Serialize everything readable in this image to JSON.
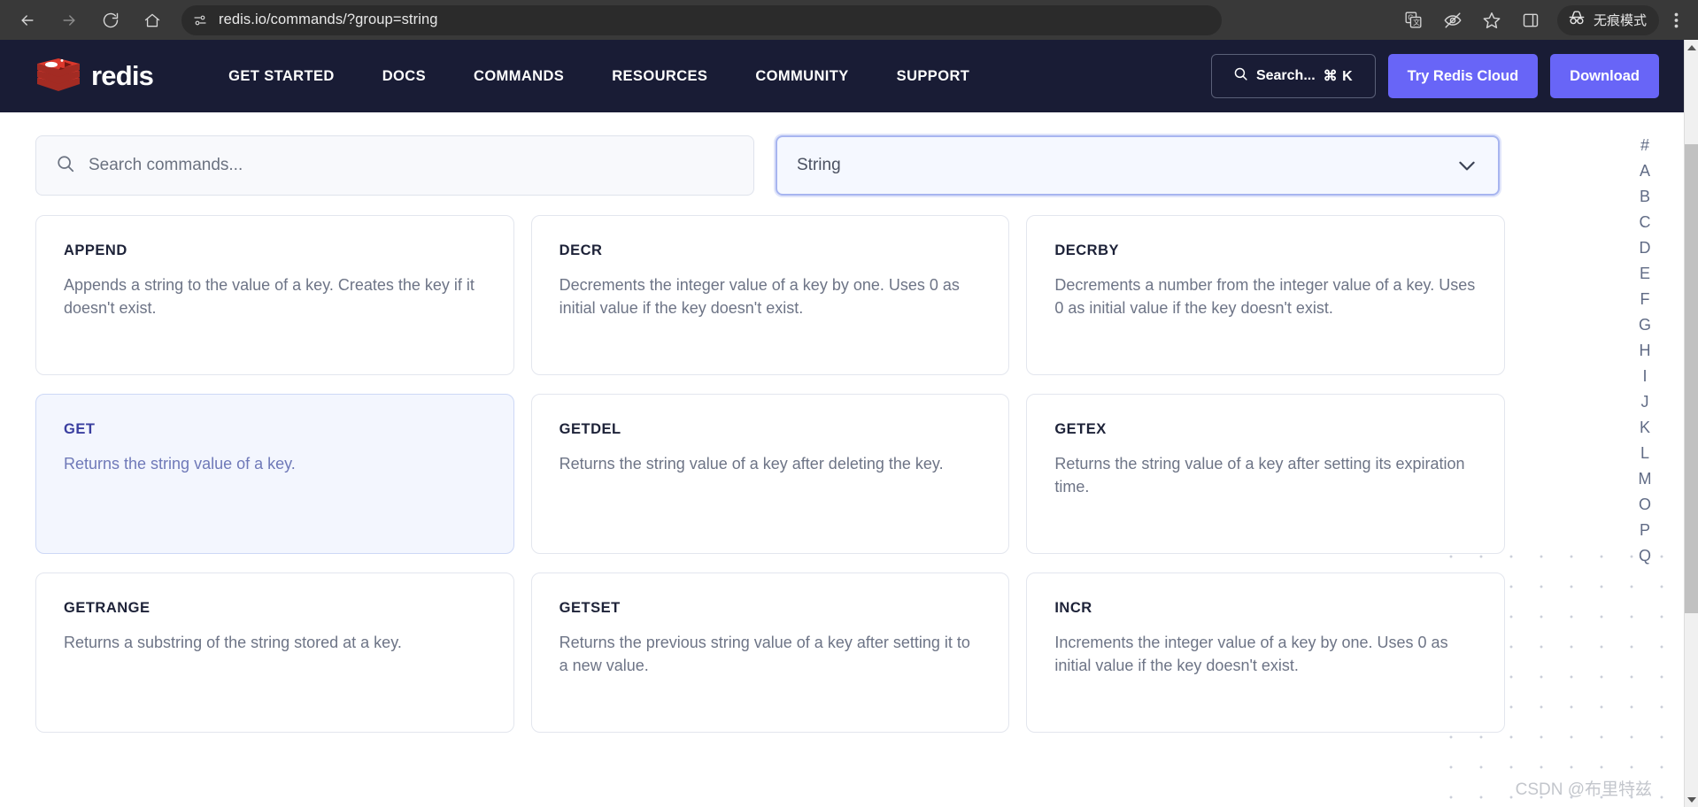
{
  "browser": {
    "url": "redis.io/commands/?group=string",
    "icons": {
      "back": "back-arrow-icon",
      "forward": "forward-arrow-icon",
      "reload": "reload-icon",
      "home": "home-icon",
      "site_info": "site-info-icon",
      "translate": "translate-icon",
      "tracking_protection": "eye-off-icon",
      "bookmark": "star-icon",
      "side_panel": "side-panel-icon",
      "incognito": "incognito-icon",
      "menu": "three-dot-menu-icon"
    },
    "incognito_label": "无痕模式"
  },
  "site_nav": {
    "brand": "redis",
    "menu": [
      "GET STARTED",
      "DOCS",
      "COMMANDS",
      "RESOURCES",
      "COMMUNITY",
      "SUPPORT"
    ],
    "search_label": "Search...",
    "search_shortcut": "⌘ K",
    "cta_primary": "Try Redis Cloud",
    "cta_secondary": "Download",
    "accent_color": "#6865f7",
    "background_color": "#191c35"
  },
  "filters": {
    "search_placeholder": "Search commands...",
    "search_value": "",
    "group_value": "String",
    "group_focused": true
  },
  "commands": [
    {
      "name": "APPEND",
      "description": "Appends a string to the value of a key. Creates the key if it doesn't exist.",
      "active": false
    },
    {
      "name": "DECR",
      "description": "Decrements the integer value of a key by one. Uses 0 as initial value if the key doesn't exist.",
      "active": false
    },
    {
      "name": "DECRBY",
      "description": "Decrements a number from the integer value of a key. Uses 0 as initial value if the key doesn't exist.",
      "active": false
    },
    {
      "name": "GET",
      "description": "Returns the string value of a key.",
      "active": true
    },
    {
      "name": "GETDEL",
      "description": "Returns the string value of a key after deleting the key.",
      "active": false
    },
    {
      "name": "GETEX",
      "description": "Returns the string value of a key after setting its expiration time.",
      "active": false
    },
    {
      "name": "GETRANGE",
      "description": "Returns a substring of the string stored at a key.",
      "active": false
    },
    {
      "name": "GETSET",
      "description": "Returns the previous string value of a key after setting it to a new value.",
      "active": false
    },
    {
      "name": "INCR",
      "description": "Increments the integer value of a key by one. Uses 0 as initial value if the key doesn't exist.",
      "active": false
    }
  ],
  "alphabet_rail": [
    "#",
    "A",
    "B",
    "C",
    "D",
    "E",
    "F",
    "G",
    "H",
    "I",
    "J",
    "K",
    "L",
    "M",
    "O",
    "P",
    "Q"
  ],
  "watermark": "CSDN @布里特兹"
}
